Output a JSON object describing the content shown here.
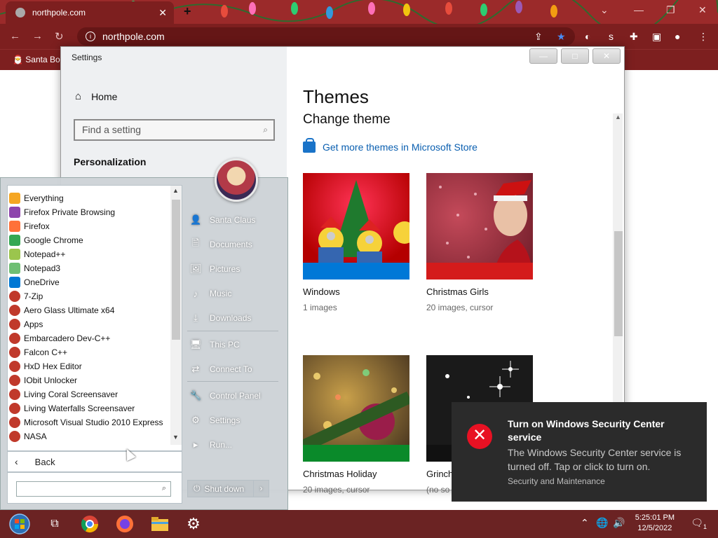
{
  "browser": {
    "tab_title": "northpole.com",
    "url": "northpole.com",
    "bookmark": "Santa Bo"
  },
  "settings": {
    "window_title": "Settings",
    "home": "Home",
    "search_placeholder": "Find a setting",
    "section": "Personalization",
    "page_title": "Themes",
    "page_subtitle": "Change theme",
    "store_link": "Get more themes in Microsoft Store",
    "themes": [
      {
        "name": "Windows",
        "meta": "1 images",
        "accent": "#0078d7"
      },
      {
        "name": "Christmas Girls",
        "meta": "20 images, cursor",
        "accent": "#d41b1b"
      },
      {
        "name": "Christmas Holiday",
        "meta": "20 images, cursor",
        "accent": "#0a8a2a"
      },
      {
        "name": "Grinch",
        "meta": "(no so",
        "accent": "#111111"
      }
    ]
  },
  "start_menu": {
    "programs": [
      "Everything",
      "Firefox Private Browsing",
      "Firefox",
      "Google Chrome",
      "Notepad++",
      "Notepad3",
      "OneDrive",
      "7-Zip",
      "Aero Glass Ultimate x64",
      "Apps",
      "Embarcadero Dev-C++",
      "Falcon C++",
      "HxD Hex Editor",
      "IObit Unlocker",
      "Living Coral Screensaver",
      "Living Waterfalls Screensaver",
      "Microsoft Visual Studio 2010 Express",
      "NASA"
    ],
    "back": "Back",
    "places": [
      "Santa Claus",
      "Documents",
      "Pictures",
      "Music",
      "Downloads",
      "This PC",
      "Connect To",
      "Control Panel",
      "Settings",
      "Run..."
    ],
    "shutdown": "Shut down"
  },
  "toast": {
    "title": "Turn on Windows Security Center service",
    "body": "The Windows Security Center service is turned off. Tap or click to turn on.",
    "source": "Security and Maintenance"
  },
  "taskbar": {
    "time": "5:25:01 PM",
    "date": "12/5/2022",
    "notification_count": "1"
  }
}
